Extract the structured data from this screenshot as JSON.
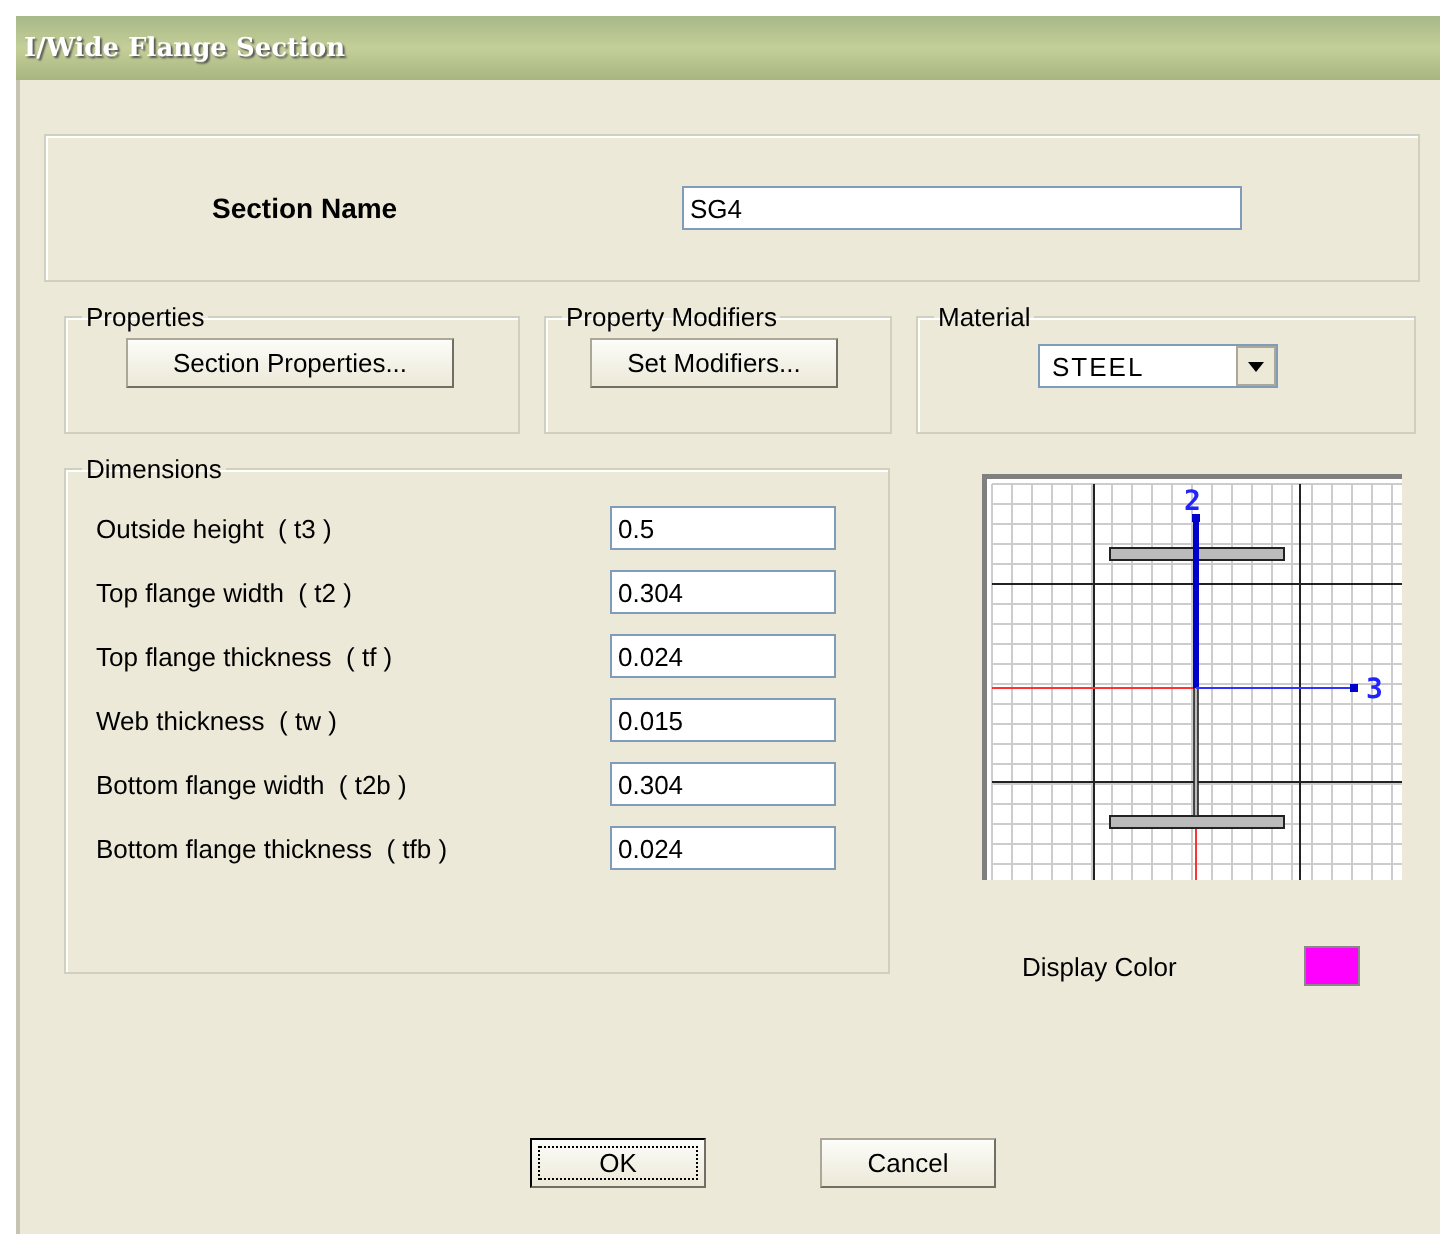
{
  "window": {
    "title": "I/Wide Flange Section"
  },
  "section_name": {
    "label": "Section Name",
    "value": "SG4"
  },
  "properties": {
    "title": "Properties",
    "button": "Section Properties..."
  },
  "property_modifiers": {
    "title": "Property Modifiers",
    "button": "Set Modifiers..."
  },
  "material": {
    "title": "Material",
    "value": "STEEL"
  },
  "dimensions": {
    "title": "Dimensions",
    "fields": [
      {
        "label": "Outside height  ( t3 )",
        "value": "0.5"
      },
      {
        "label": "Top flange width  ( t2 )",
        "value": "0.304"
      },
      {
        "label": "Top flange thickness  ( tf )",
        "value": "0.024"
      },
      {
        "label": "Web thickness  ( tw )",
        "value": "0.015"
      },
      {
        "label": "Bottom flange width  ( t2b )",
        "value": "0.304"
      },
      {
        "label": "Bottom flange thickness  ( tfb )",
        "value": "0.024"
      }
    ]
  },
  "preview": {
    "axis_vertical": "2",
    "axis_horizontal": "3"
  },
  "display_color": {
    "label": "Display Color",
    "color": "#ff00ff"
  },
  "buttons": [
    {
      "label": "OK",
      "kind": "default"
    },
    {
      "label": "Cancel",
      "kind": "normal"
    }
  ]
}
